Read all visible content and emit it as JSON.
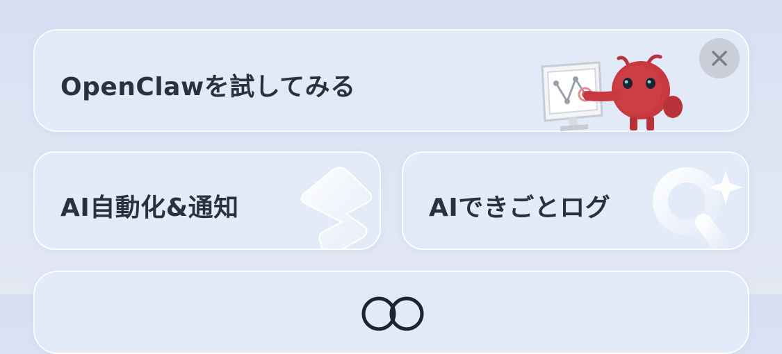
{
  "banner": {
    "label": "OpenClawを試してみる",
    "close_icon": "close-icon",
    "illustration": "red-mascot-pointing-at-monitor"
  },
  "cards": {
    "automation": {
      "label": "AI自動化&通知",
      "icon": "lightning-bolt-icon"
    },
    "log": {
      "label": "AIできごとログ",
      "icon": "sparkle-search-icon"
    }
  },
  "bottom_card": {
    "icon": "rings-icon"
  },
  "colors": {
    "text": "#2b3040",
    "mascot_red": "#c8393f",
    "close_bg": "#c9ced8",
    "card_bg": "#e4ecfa"
  }
}
